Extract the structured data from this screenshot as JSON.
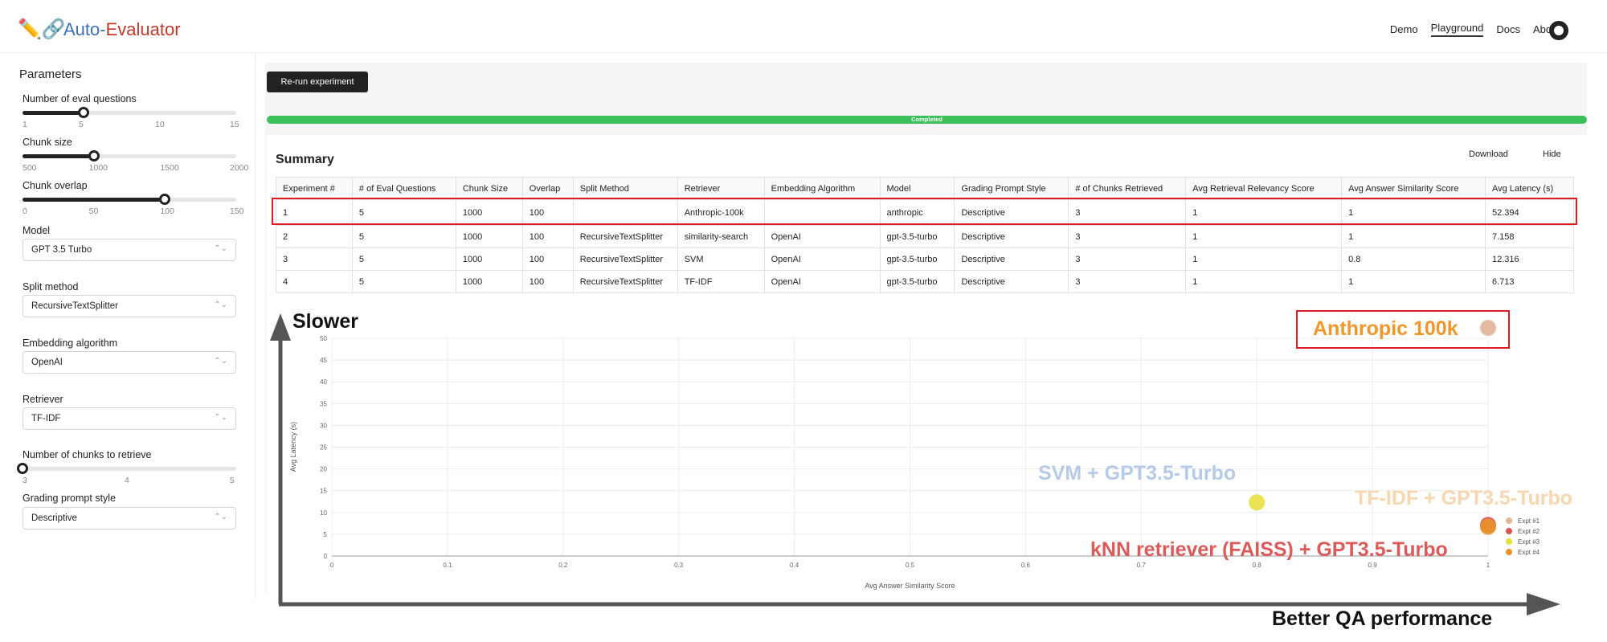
{
  "header": {
    "logo_icons": "✏️🔗",
    "title_part1": "Auto-",
    "title_part2": "Evaluator",
    "nav": [
      {
        "label": "Demo",
        "active": false
      },
      {
        "label": "Playground",
        "active": true
      },
      {
        "label": "Docs",
        "active": false
      },
      {
        "label": "About",
        "active": false
      }
    ],
    "github_icon": "github-icon"
  },
  "sidebar": {
    "heading": "Parameters",
    "eval_questions": {
      "label": "Number of eval questions",
      "value": 5,
      "min": 1,
      "max": 15,
      "ticks": [
        "1",
        "5",
        "10",
        "15"
      ]
    },
    "chunk_size": {
      "label": "Chunk size",
      "value": 1000,
      "min": 500,
      "max": 2000,
      "ticks": [
        "500",
        "1000",
        "1500",
        "2000"
      ]
    },
    "chunk_overlap": {
      "label": "Chunk overlap",
      "value": 100,
      "min": 0,
      "max": 150,
      "ticks": [
        "0",
        "50",
        "100",
        "150"
      ]
    },
    "model": {
      "label": "Model",
      "value": "GPT 3.5 Turbo"
    },
    "split_method": {
      "label": "Split method",
      "value": "RecursiveTextSplitter"
    },
    "embedding": {
      "label": "Embedding algorithm",
      "value": "OpenAI"
    },
    "retriever": {
      "label": "Retriever",
      "value": "TF-IDF"
    },
    "num_chunks": {
      "label": "Number of chunks to retrieve",
      "value": 3,
      "min": 3,
      "max": 5,
      "ticks": [
        "3",
        "4",
        "5"
      ]
    },
    "grading_style": {
      "label": "Grading prompt style",
      "value": "Descriptive"
    }
  },
  "main": {
    "rerun_label": "Re-run experiment",
    "progress_label": "Completed",
    "progress_value": 1.0,
    "summary_title": "Summary",
    "download_label": "Download",
    "hide_label": "Hide"
  },
  "table": {
    "columns": [
      "Experiment #",
      "# of Eval Questions",
      "Chunk Size",
      "Overlap",
      "Split Method",
      "Retriever",
      "Embedding Algorithm",
      "Model",
      "Grading Prompt Style",
      "# of Chunks Retrieved",
      "Avg Retrieval Relevancy Score",
      "Avg Answer Similarity Score",
      "Avg Latency (s)"
    ],
    "rows": [
      [
        "1",
        "5",
        "1000",
        "100",
        "",
        "Anthropic-100k",
        "",
        "anthropic",
        "Descriptive",
        "3",
        "1",
        "1",
        "52.394"
      ],
      [
        "2",
        "5",
        "1000",
        "100",
        "RecursiveTextSplitter",
        "similarity-search",
        "OpenAI",
        "gpt-3.5-turbo",
        "Descriptive",
        "3",
        "1",
        "1",
        "7.158"
      ],
      [
        "3",
        "5",
        "1000",
        "100",
        "RecursiveTextSplitter",
        "SVM",
        "OpenAI",
        "gpt-3.5-turbo",
        "Descriptive",
        "3",
        "1",
        "0.8",
        "12.316"
      ],
      [
        "4",
        "5",
        "1000",
        "100",
        "RecursiveTextSplitter",
        "TF-IDF",
        "OpenAI",
        "gpt-3.5-turbo",
        "Descriptive",
        "3",
        "1",
        "1",
        "6.713"
      ]
    ]
  },
  "chart_data": {
    "type": "scatter",
    "xlabel": "Avg Answer Similarity Score",
    "ylabel": "Avg Latency (s)",
    "xlim": [
      0,
      1
    ],
    "ylim": [
      0,
      50
    ],
    "xticks": [
      "0",
      "0.1",
      "0.2",
      "0.3",
      "0.4",
      "0.5",
      "0.6",
      "0.7",
      "0.8",
      "0.9",
      "1"
    ],
    "yticks": [
      "0",
      "5",
      "10",
      "15",
      "20",
      "25",
      "30",
      "35",
      "40",
      "45",
      "50"
    ],
    "grid": true,
    "legend_position": "right",
    "series": [
      {
        "name": "Expt #1",
        "color": "#e2b49a",
        "points": [
          {
            "x": 1,
            "y": 52.394
          }
        ]
      },
      {
        "name": "Expt #2",
        "color": "#d9534f",
        "points": [
          {
            "x": 1,
            "y": 7.158
          }
        ]
      },
      {
        "name": "Expt #3",
        "color": "#e8e040",
        "points": [
          {
            "x": 0.8,
            "y": 12.316
          }
        ]
      },
      {
        "name": "Expt #4",
        "color": "#e8922a",
        "points": [
          {
            "x": 1,
            "y": 6.713
          }
        ]
      }
    ]
  },
  "annotations": {
    "slower": "Slower",
    "better": "Better QA performance",
    "anthropic": {
      "text": "Anthropic 100k",
      "color": "#f0962a"
    },
    "svm": {
      "text": "SVM + GPT3.5-Turbo",
      "color": "#b5cbe8"
    },
    "tfidf": {
      "text": "TF-IDF + GPT3.5-Turbo",
      "color": "#f7d7b0"
    },
    "knn": {
      "text": "kNN retriever (FAISS) + GPT3.5-Turbo",
      "color": "#dc5a5a"
    },
    "highlight_color": "#e01b24"
  }
}
